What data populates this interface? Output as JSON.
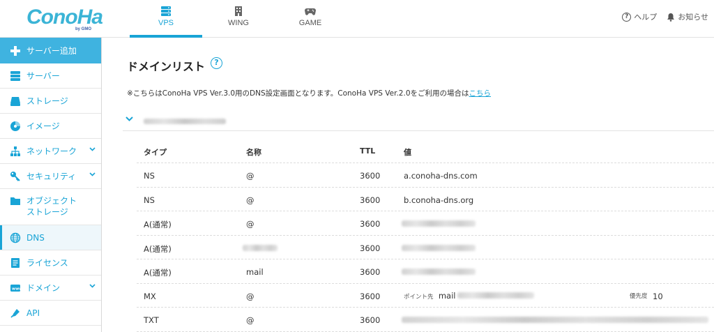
{
  "header": {
    "logo": "ConoHa",
    "logo_sub": "by GMO",
    "tabs": [
      {
        "label": "VPS",
        "icon": "server-icon",
        "active": true
      },
      {
        "label": "WING",
        "icon": "building-icon",
        "active": false
      },
      {
        "label": "GAME",
        "icon": "gamepad-icon",
        "active": false
      }
    ],
    "help_label": "ヘルプ",
    "notify_label": "お知らせ"
  },
  "sidebar": {
    "items": [
      {
        "label": "サーバー追加",
        "icon": "plus-icon"
      },
      {
        "label": "サーバー",
        "icon": "server-icon"
      },
      {
        "label": "ストレージ",
        "icon": "storage-icon"
      },
      {
        "label": "イメージ",
        "icon": "disc-icon"
      },
      {
        "label": "ネットワーク",
        "icon": "network-icon",
        "expandable": true
      },
      {
        "label": "セキュリティ",
        "icon": "key-icon",
        "expandable": true
      },
      {
        "label": "オブジェクト",
        "label2": "ストレージ",
        "icon": "folder-icon"
      },
      {
        "label": "DNS",
        "icon": "globe-icon",
        "active": true
      },
      {
        "label": "ライセンス",
        "icon": "document-icon"
      },
      {
        "label": "ドメイン",
        "icon": "domain-icon",
        "expandable": true
      },
      {
        "label": "API",
        "icon": "api-icon"
      }
    ]
  },
  "main": {
    "title": "ドメインリスト",
    "notice_text": "※こちらはConoHa VPS Ver.3.0用のDNS設定画面となります。ConoHa VPS Ver.2.0をご利用の場合は",
    "notice_link": "こちら",
    "columns": {
      "type": "タイプ",
      "name": "名称",
      "ttl": "TTL",
      "value": "値"
    },
    "records": [
      {
        "type": "NS",
        "name": "@",
        "ttl": "3600",
        "value": "a.conoha-dns.com"
      },
      {
        "type": "NS",
        "name": "@",
        "ttl": "3600",
        "value": "b.conoha-dns.org"
      },
      {
        "type": "A(通常)",
        "name": "@",
        "ttl": "3600",
        "value": ""
      },
      {
        "type": "A(通常)",
        "name": "",
        "ttl": "3600",
        "value": ""
      },
      {
        "type": "A(通常)",
        "name": "mail",
        "ttl": "3600",
        "value": ""
      },
      {
        "type": "MX",
        "name": "@",
        "ttl": "3600",
        "value_prefix": "ポイント先",
        "value": "mail",
        "priority_label": "優先度",
        "priority": "10"
      },
      {
        "type": "TXT",
        "name": "@",
        "ttl": "3600",
        "value": ""
      }
    ]
  },
  "colors": {
    "accent": "#19a4d6",
    "sidebar_add_bg": "#3fb3e0"
  }
}
